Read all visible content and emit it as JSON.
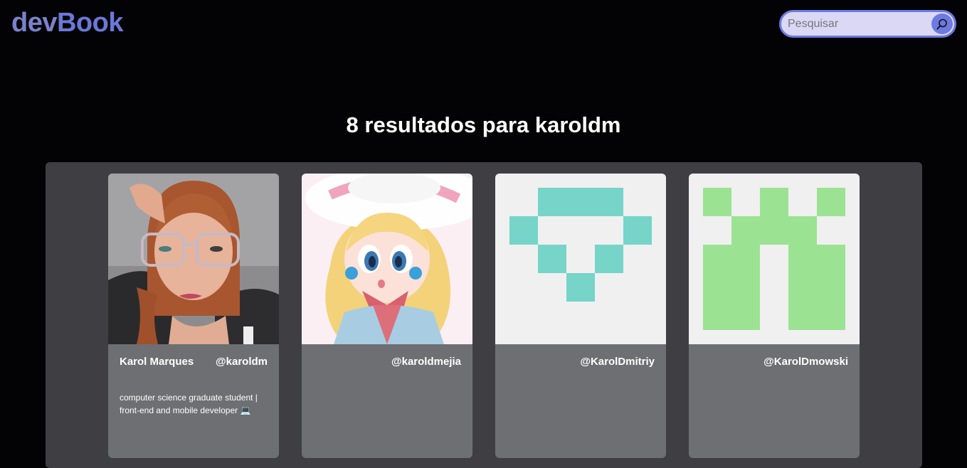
{
  "header": {
    "logo_dev": "dev",
    "logo_book": "Book",
    "search_placeholder": "Pesquisar",
    "search_icon": "search-icon"
  },
  "results": {
    "title": "8 resultados para karoldm"
  },
  "cards": [
    {
      "name": "Karol Marques",
      "handle": "@karoldm",
      "bio": "computer science graduate student | front-end and mobile developer 💻",
      "avatar": "photo-avatar"
    },
    {
      "name": "",
      "handle": "@karoldmejia",
      "bio": "",
      "avatar": "cartoon-princess-avatar"
    },
    {
      "name": "",
      "handle": "@KarolDmitriy",
      "bio": "",
      "avatar": "identicon-avatar",
      "identicon_color": "#76d4c8"
    },
    {
      "name": "",
      "handle": "@KarolDmowski",
      "bio": "",
      "avatar": "identicon-avatar",
      "identicon_color": "#9be392"
    }
  ],
  "colors": {
    "background": "#030306",
    "accent": "#6d7ae0",
    "panel": "#3f3f43",
    "card": "#6e6f73"
  }
}
